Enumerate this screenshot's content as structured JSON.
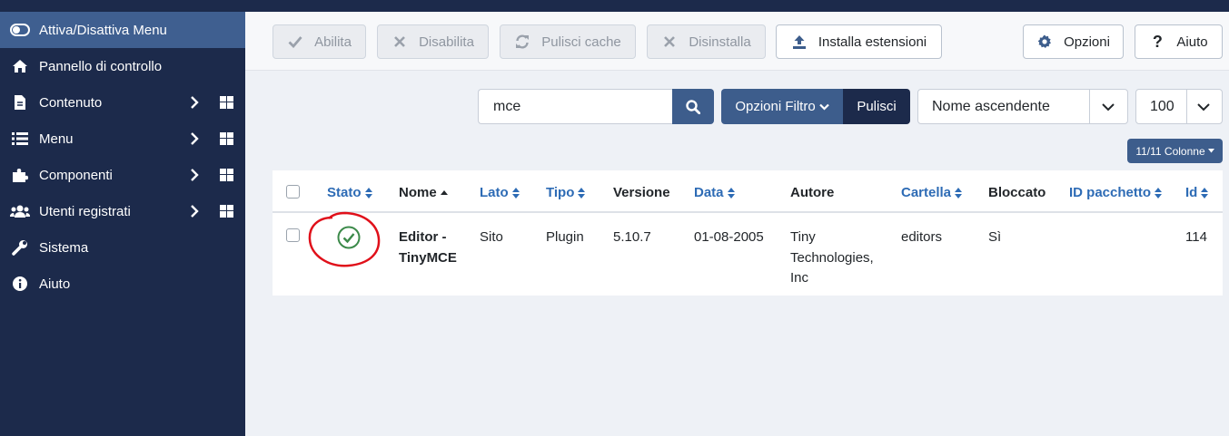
{
  "sidebar": {
    "items": [
      {
        "label": "Attiva/Disattiva Menu",
        "icon": "toggle-icon"
      },
      {
        "label": "Pannello di controllo",
        "icon": "home-icon"
      },
      {
        "label": "Contenuto",
        "icon": "file-icon"
      },
      {
        "label": "Menu",
        "icon": "list-icon"
      },
      {
        "label": "Componenti",
        "icon": "puzzle-icon"
      },
      {
        "label": "Utenti registrati",
        "icon": "users-icon"
      },
      {
        "label": "Sistema",
        "icon": "wrench-icon"
      },
      {
        "label": "Aiuto",
        "icon": "info-icon"
      }
    ]
  },
  "toolbar": {
    "enable": "Abilita",
    "disable": "Disabilita",
    "clear_cache": "Pulisci cache",
    "uninstall": "Disinstalla",
    "install": "Installa estensioni",
    "options": "Opzioni",
    "help": "Aiuto"
  },
  "filters": {
    "search_value": "mce",
    "filter_options": "Opzioni Filtro",
    "clear": "Pulisci",
    "sort": "Nome ascendente",
    "limit": "100",
    "columns": "11/11 Colonne"
  },
  "table": {
    "headers": {
      "status": "Stato",
      "name": "Nome",
      "side": "Lato",
      "type": "Tipo",
      "version": "Versione",
      "date": "Data",
      "author": "Autore",
      "folder": "Cartella",
      "locked": "Bloccato",
      "package_id": "ID pacchetto",
      "id": "Id"
    },
    "rows": [
      {
        "name_line1": "Editor -",
        "name_line2": "TinyMCE",
        "side": "Sito",
        "type": "Plugin",
        "version": "5.10.7",
        "date": "01-08-2005",
        "author_line1": "Tiny",
        "author_line2": "Technologies,",
        "author_line3": "Inc",
        "folder": "editors",
        "locked": "Sì",
        "package_id": "",
        "id": "114"
      }
    ]
  },
  "colors": {
    "sidebar_bg": "#1c2a4b",
    "sidebar_active": "#3f5f90",
    "accent": "#3d5d8c",
    "link": "#2d6bb5",
    "success": "#3c8a4a",
    "annotation": "#e0101a"
  }
}
